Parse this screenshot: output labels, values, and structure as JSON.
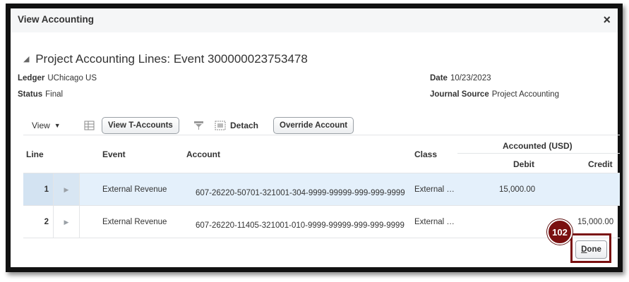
{
  "dialog": {
    "title": "View Accounting",
    "close_glyph": "×"
  },
  "section": {
    "toggle_glyph": "◢",
    "title": "Project Accounting Lines: Event 300000023753478"
  },
  "fields": {
    "ledger_label": "Ledger",
    "ledger_value": "UChicago US",
    "status_label": "Status",
    "status_value": "Final",
    "date_label": "Date",
    "date_value": "10/23/2023",
    "journal_source_label": "Journal Source",
    "journal_source_value": "Project Accounting"
  },
  "toolbar": {
    "view_label": "View",
    "view_caret": "▼",
    "view_t_accounts_label": "View T-Accounts",
    "detach_label": "Detach",
    "override_account_label": "Override Account",
    "icons": [
      "table-view-icon",
      "filter-icon",
      "detach-icon"
    ]
  },
  "table": {
    "headers": {
      "line": "Line",
      "event": "Event",
      "account": "Account",
      "class": "Class",
      "accounted": "Accounted (USD)",
      "debit": "Debit",
      "credit": "Credit"
    },
    "rows": [
      {
        "line": "1",
        "expand": "▶",
        "event": "External Revenue",
        "account": "607-26220-50701-321001-304-9999-99999-999-999-9999",
        "class": "External …",
        "debit": "15,000.00",
        "credit": ""
      },
      {
        "line": "2",
        "expand": "▶",
        "event": "External Revenue",
        "account": "607-26220-11405-321001-010-9999-99999-999-999-9999",
        "class": "External …",
        "debit": "",
        "credit": "15,000.00"
      }
    ]
  },
  "footer": {
    "step_badge": "102",
    "done_mnemonic": "D",
    "done_rest": "one"
  },
  "colors": {
    "accent_badge": "#7a1010",
    "selected_row": "#e4f0fb",
    "frame_border": "#111111"
  }
}
